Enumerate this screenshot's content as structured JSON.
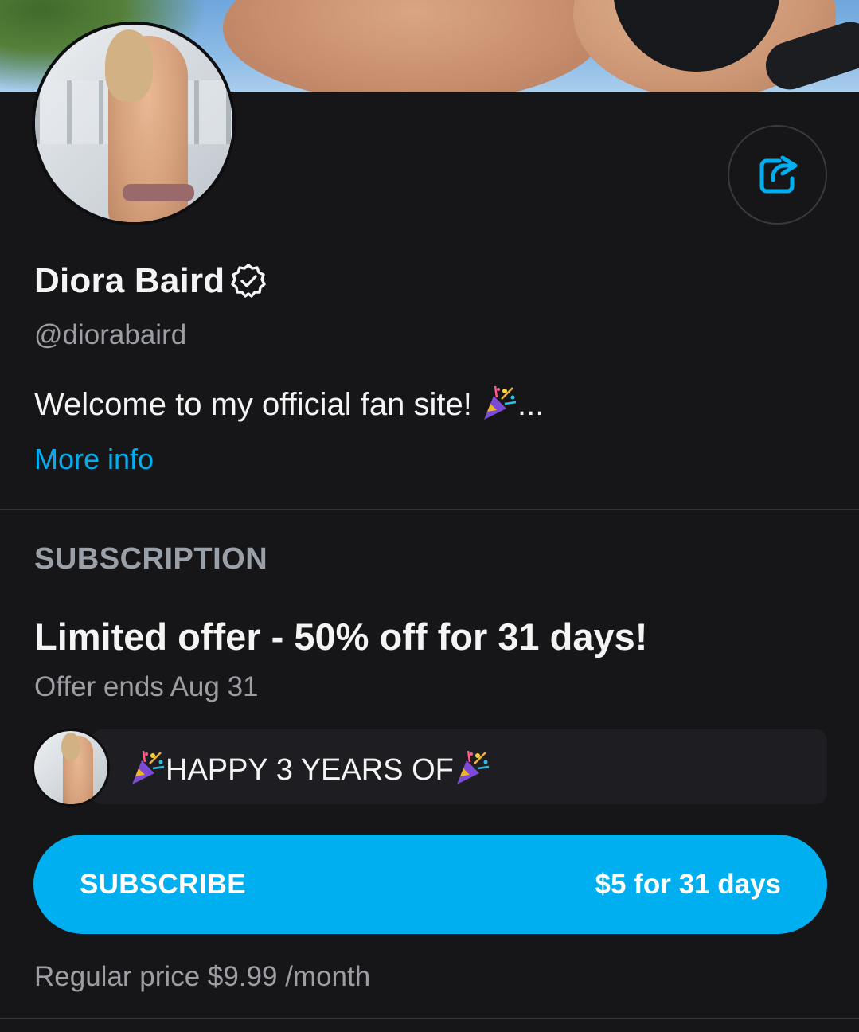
{
  "profile": {
    "name": "Diora Baird",
    "handle": "@diorabaird",
    "bio": "Welcome to my official fan site! ",
    "bio_ellipsis": "...",
    "more_info": "More info"
  },
  "subscription": {
    "section_title": "SUBSCRIPTION",
    "offer_title": "Limited offer - 50% off for 31 days!",
    "offer_ends": "Offer ends Aug 31",
    "message": "HAPPY 3 YEARS OF",
    "button_label": "SUBSCRIBE",
    "button_price": "$5 for 31 days",
    "regular_price": "Regular price $9.99 /month"
  },
  "icons": {
    "share": "share-icon",
    "verified": "verified-badge-icon",
    "party": "party-popper-icon"
  },
  "colors": {
    "background": "#161618",
    "accent": "#00aff0",
    "muted_text": "#9c9ea3"
  }
}
